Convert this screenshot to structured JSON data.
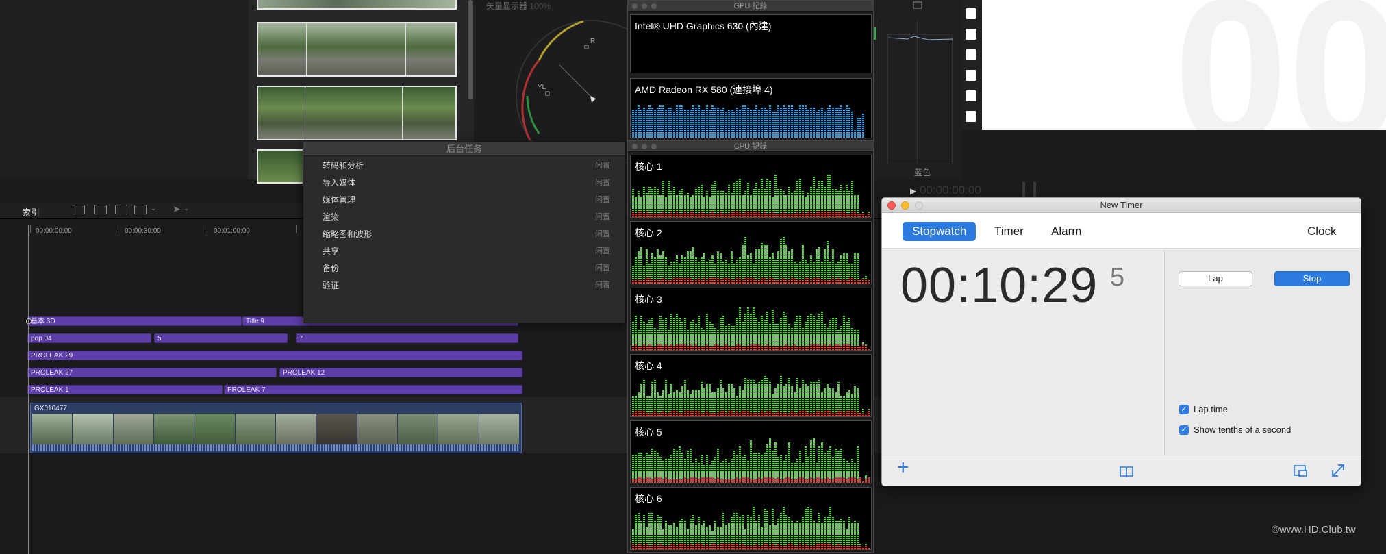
{
  "scope": {
    "title": "矢量显示器",
    "zoom": "100%",
    "labels": [
      "R",
      "YL"
    ]
  },
  "right_scope": {
    "label": "蓝色",
    "timecode": "00:00:00:00"
  },
  "timeline": {
    "index_label": "索引",
    "timecodes": [
      "00:00:00:00",
      "00:00:30:00",
      "00:01:00:00"
    ],
    "clip_rows": [
      [
        {
          "name": "基本 3D"
        },
        {
          "name": "Title 9"
        }
      ],
      [
        {
          "name": "pop 04"
        },
        {
          "name": "5"
        },
        {
          "name": "7"
        }
      ],
      [
        {
          "name": "PROLEAK 29"
        }
      ],
      [
        {
          "name": "PROLEAK 27"
        },
        {
          "name": "PROLEAK 12"
        }
      ],
      [
        {
          "name": "PROLEAK 1"
        },
        {
          "name": "PROLEAK 7"
        }
      ]
    ],
    "primary_clip": "GX010477"
  },
  "bg_tasks": {
    "title": "后台任务",
    "items": [
      {
        "name": "转码和分析",
        "status": "闲置"
      },
      {
        "name": "导入媒体",
        "status": "闲置"
      },
      {
        "name": "媒体管理",
        "status": "闲置"
      },
      {
        "name": "渲染",
        "status": "闲置"
      },
      {
        "name": "缩略图和波形",
        "status": "闲置"
      },
      {
        "name": "共享",
        "status": "闲置"
      },
      {
        "name": "备份",
        "status": "闲置"
      },
      {
        "name": "验证",
        "status": "闲置"
      }
    ]
  },
  "gpu_window": {
    "title": "GPU 記錄",
    "gpus": [
      "Intel® UHD Graphics 630 (內建)",
      "AMD Radeon RX 580 (連接埠 4)"
    ]
  },
  "cpu_window": {
    "title": "CPU 記錄",
    "cores": [
      "核心 1",
      "核心 2",
      "核心 3",
      "核心 4",
      "核心 5",
      "核心 6"
    ]
  },
  "timer": {
    "window_title": "New Timer",
    "tabs": [
      {
        "label": "Stopwatch",
        "active": true
      },
      {
        "label": "Timer",
        "active": false
      },
      {
        "label": "Alarm",
        "active": false
      }
    ],
    "clock_tab": "Clock",
    "time": "00:10:29",
    "tenths": "5",
    "lap_label": "Lap",
    "stop_label": "Stop",
    "options": [
      {
        "label": "Lap time",
        "checked": true
      },
      {
        "label": "Show tenths of a second",
        "checked": true
      }
    ]
  },
  "watermark": "©www.HD.Club.tw",
  "colors": {
    "accent": "#2b7be0",
    "clip_purple": "#5d3da8",
    "cpu_user": "#56d43d",
    "cpu_system": "#e23b2b",
    "gpu_bar": "#2f9fe3"
  }
}
